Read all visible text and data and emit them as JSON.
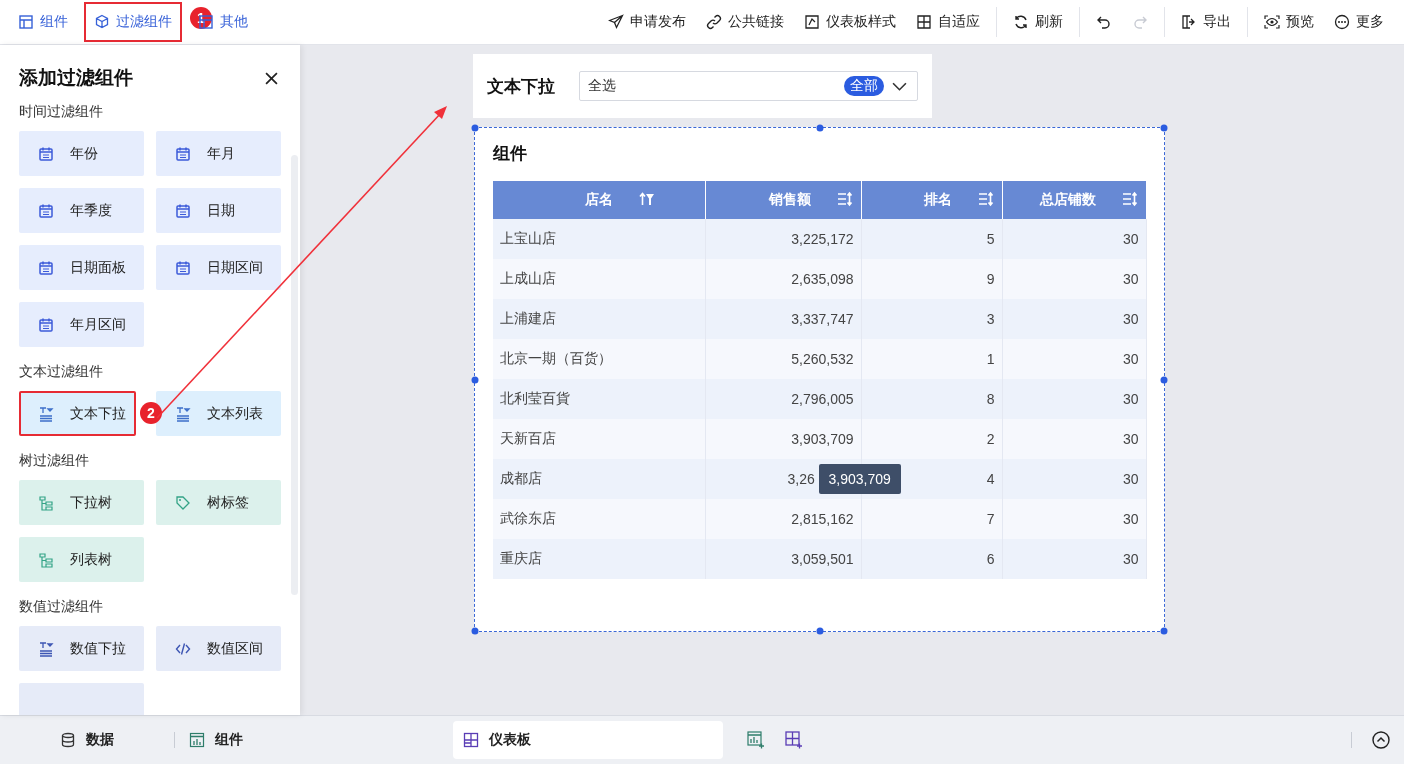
{
  "toolbar": {
    "left": [
      {
        "label": "组件",
        "highlighted": false
      },
      {
        "label": "过滤组件",
        "highlighted": true,
        "badge": "1"
      },
      {
        "label": "其他",
        "highlighted": false
      }
    ],
    "right_groups": [
      [
        {
          "kind": "send",
          "label": "申请发布",
          "disabled": false
        },
        {
          "kind": "link",
          "label": "公共链接",
          "disabled": false
        },
        {
          "kind": "style",
          "label": "仪表板样式",
          "disabled": false
        },
        {
          "kind": "fit",
          "label": "自适应",
          "disabled": false
        }
      ],
      [
        {
          "kind": "refresh",
          "label": "刷新",
          "disabled": false
        }
      ],
      [
        {
          "kind": "undo",
          "disabled": false
        },
        {
          "kind": "redo",
          "disabled": true
        }
      ],
      [
        {
          "kind": "export",
          "label": "导出",
          "disabled": false
        }
      ],
      [
        {
          "kind": "preview",
          "label": "预览",
          "disabled": false
        },
        {
          "kind": "more",
          "label": "更多",
          "disabled": false
        }
      ]
    ]
  },
  "panel": {
    "title": "添加过滤组件",
    "groups": [
      {
        "kind": "time",
        "title": "时间过滤组件",
        "items": [
          {
            "label": "年份",
            "highlighted": false
          },
          {
            "label": "年月",
            "highlighted": false
          },
          {
            "label": "年季度",
            "highlighted": false
          },
          {
            "label": "日期",
            "highlighted": false
          },
          {
            "label": "日期面板",
            "highlighted": false
          },
          {
            "label": "日期区间",
            "highlighted": false
          },
          {
            "label": "年月区间",
            "highlighted": false
          }
        ]
      },
      {
        "kind": "text",
        "title": "文本过滤组件",
        "items": [
          {
            "label": "文本下拉",
            "highlighted": true,
            "badge": "2"
          },
          {
            "label": "文本列表",
            "highlighted": false
          }
        ]
      },
      {
        "kind": "tree",
        "title": "树过滤组件",
        "items": [
          {
            "label": "下拉树",
            "highlighted": false
          },
          {
            "label": "树标签",
            "highlighted": false
          },
          {
            "label": "列表树",
            "highlighted": false
          }
        ]
      },
      {
        "kind": "number",
        "title": "数值过滤组件",
        "items": [
          {
            "label": "数值下拉",
            "highlighted": false
          },
          {
            "label": "数值区间",
            "highlighted": false
          }
        ]
      }
    ]
  },
  "filter_widget": {
    "title": "文本下拉",
    "value": "全选",
    "tag": "全部"
  },
  "table_widget": {
    "title": "组件",
    "columns": [
      {
        "label": "店名",
        "filtered": true
      },
      {
        "label": "销售额",
        "filtered": false
      },
      {
        "label": "排名",
        "filtered": false
      },
      {
        "label": "总店铺数",
        "filtered": false
      }
    ],
    "rows": [
      {
        "cells": [
          "上宝山店",
          "3,225,172",
          "5",
          "30"
        ]
      },
      {
        "cells": [
          "上成山店",
          "2,635,098",
          "9",
          "30"
        ]
      },
      {
        "cells": [
          "上浦建店",
          "3,337,747",
          "3",
          "30"
        ]
      },
      {
        "cells": [
          "北京一期（百货）",
          "5,260,532",
          "1",
          "30"
        ]
      },
      {
        "cells": [
          "北利莹百貨",
          "2,796,005",
          "8",
          "30"
        ]
      },
      {
        "cells": [
          "天新百店",
          "3,903,709",
          "2",
          "30"
        ]
      },
      {
        "cells": [
          "成都店",
          "3,26",
          "4",
          "30"
        ],
        "tooltip": "3,903,709"
      },
      {
        "cells": [
          "武徐东店",
          "2,815,162",
          "7",
          "30"
        ]
      },
      {
        "cells": [
          "重庆店",
          "3,059,501",
          "6",
          "30"
        ]
      }
    ]
  },
  "bottom_bar": {
    "tabs": [
      {
        "label": "数据",
        "selected": false
      },
      {
        "label": "组件",
        "selected": false
      },
      {
        "label": "仪表板",
        "selected": true
      }
    ]
  }
}
